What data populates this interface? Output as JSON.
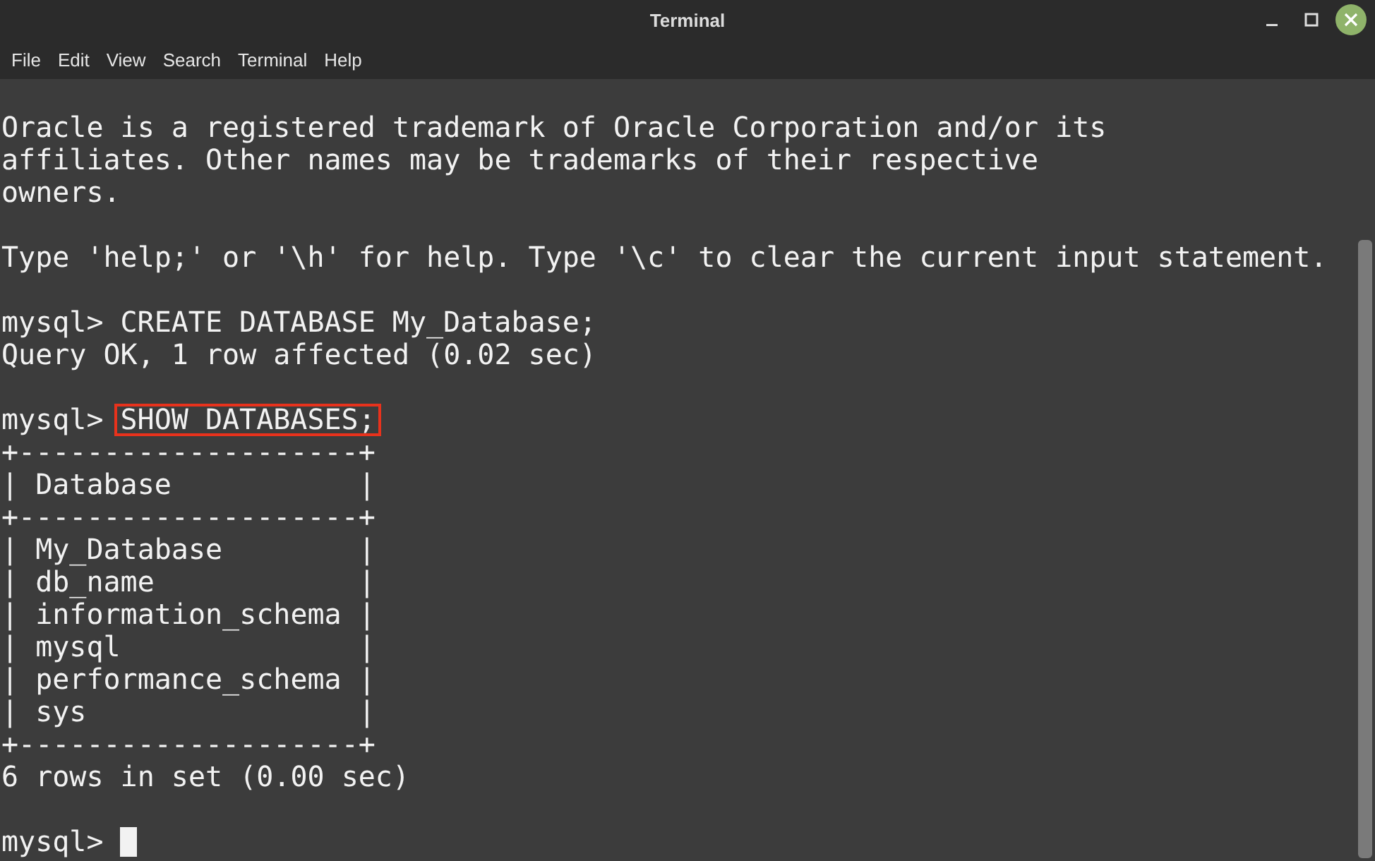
{
  "window": {
    "title": "Terminal"
  },
  "menu": [
    "File",
    "Edit",
    "View",
    "Search",
    "Terminal",
    "Help"
  ],
  "lines": [
    {
      "kind": "blank"
    },
    {
      "kind": "output",
      "text": "Oracle is a registered trademark of Oracle Corporation and/or its"
    },
    {
      "kind": "output",
      "text": "affiliates. Other names may be trademarks of their respective"
    },
    {
      "kind": "output",
      "text": "owners."
    },
    {
      "kind": "blank"
    },
    {
      "kind": "output",
      "text": "Type 'help;' or '\\h' for help. Type '\\c' to clear the current input statement."
    },
    {
      "kind": "blank"
    },
    {
      "kind": "command",
      "prompt": "mysql>",
      "command": "CREATE DATABASE My_Database;",
      "highlighted": false
    },
    {
      "kind": "output",
      "text": "Query OK, 1 row affected (0.02 sec)"
    },
    {
      "kind": "blank"
    },
    {
      "kind": "command",
      "prompt": "mysql>",
      "command": "SHOW DATABASES;",
      "highlighted": true
    },
    {
      "kind": "output",
      "text": "+--------------------+"
    },
    {
      "kind": "output",
      "text": "| Database           |"
    },
    {
      "kind": "output",
      "text": "+--------------------+"
    },
    {
      "kind": "output",
      "text": "| My_Database        |"
    },
    {
      "kind": "output",
      "text": "| db_name            |"
    },
    {
      "kind": "output",
      "text": "| information_schema |"
    },
    {
      "kind": "output",
      "text": "| mysql              |"
    },
    {
      "kind": "output",
      "text": "| performance_schema |"
    },
    {
      "kind": "output",
      "text": "| sys                |"
    },
    {
      "kind": "output",
      "text": "+--------------------+"
    },
    {
      "kind": "output",
      "text": "6 rows in set (0.00 sec)"
    },
    {
      "kind": "blank"
    },
    {
      "kind": "input",
      "prompt": "mysql>",
      "cursor": true
    }
  ]
}
